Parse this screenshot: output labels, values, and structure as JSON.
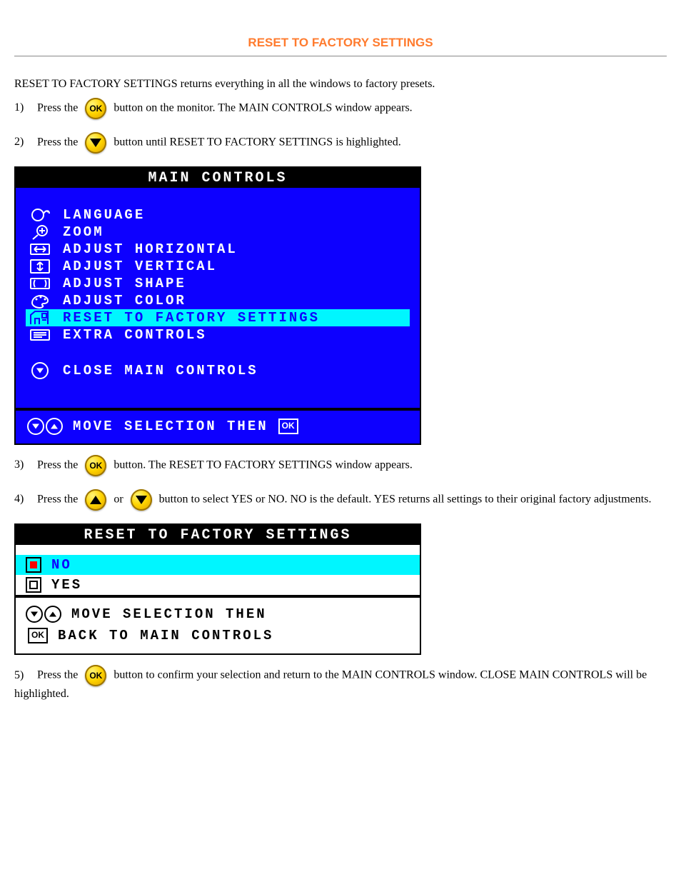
{
  "heading": "RESET TO FACTORY SETTINGS",
  "intro": "RESET TO FACTORY SETTINGS returns everything in all the windows to factory presets.",
  "steps": {
    "s1": {
      "num": "1)",
      "text_before": "Press the ",
      "text_after": " button on the monitor. The MAIN CONTROLS window appears."
    },
    "s2": {
      "num": "2)",
      "text_before": "Press the ",
      "text_after": " button until RESET TO FACTORY SETTINGS is highlighted."
    },
    "s3": {
      "num": "3)",
      "text_before": "Press the ",
      "text_after": " button. The RESET TO FACTORY SETTINGS window appears."
    },
    "s4": {
      "num": "4)",
      "text_before": "Press the ",
      "text_mid": " or ",
      "text_after": " button to select YES or NO. NO is the default. YES returns all settings to their original factory adjustments."
    },
    "s5": {
      "num": "5)",
      "text_before": "Press the ",
      "text_after": " button to confirm your selection and return to the MAIN CONTROLS window. CLOSE MAIN CONTROLS will be highlighted."
    }
  },
  "osd1": {
    "title": "MAIN CONTROLS",
    "items": [
      {
        "icon": "lang",
        "label": "LANGUAGE"
      },
      {
        "icon": "zoom",
        "label": "ZOOM"
      },
      {
        "icon": "horiz",
        "label": "ADJUST HORIZONTAL"
      },
      {
        "icon": "vert",
        "label": "ADJUST VERTICAL"
      },
      {
        "icon": "shape",
        "label": "ADJUST SHAPE"
      },
      {
        "icon": "color",
        "label": "ADJUST COLOR"
      },
      {
        "icon": "factory",
        "label": "RESET TO FACTORY SETTINGS",
        "highlighted": true
      },
      {
        "icon": "extra",
        "label": "EXTRA CONTROLS"
      }
    ],
    "close_label": "CLOSE MAIN CONTROLS",
    "footer": "MOVE SELECTION THEN"
  },
  "osd2": {
    "title": "RESET TO FACTORY SETTINGS",
    "options": [
      {
        "label": "NO",
        "selected": true,
        "highlighted": true
      },
      {
        "label": "YES",
        "selected": false,
        "highlighted": false
      }
    ],
    "footer_line1": "MOVE SELECTION THEN",
    "footer_line2": "BACK TO MAIN CONTROLS"
  }
}
